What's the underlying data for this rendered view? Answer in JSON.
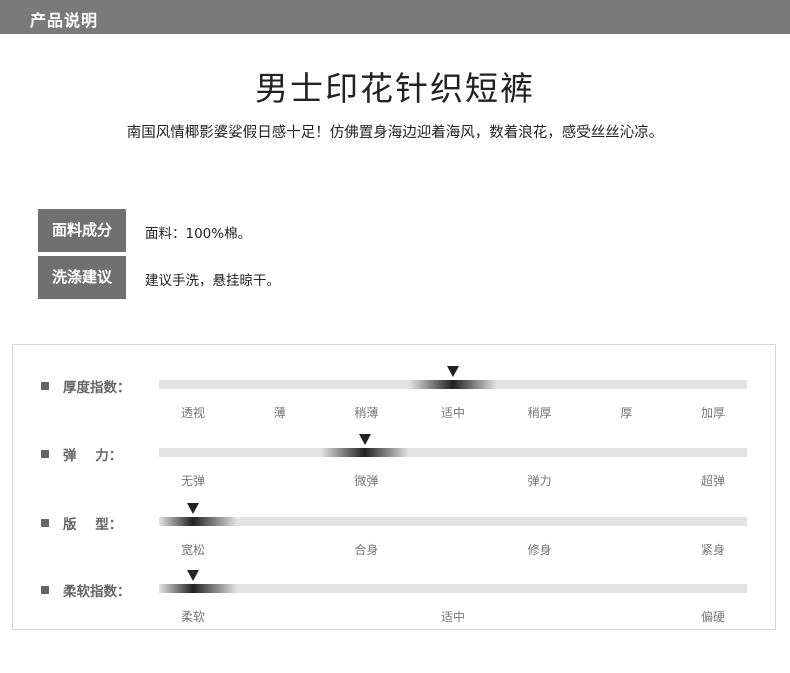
{
  "header": {
    "title": "产品说明"
  },
  "product": {
    "title": "男士印花针织短裤",
    "description": "南国风情椰影婆娑假日感十足！仿佛置身海边迎着海风，数着浪花，感受丝丝沁凉。"
  },
  "specs": [
    {
      "label": "面料成分",
      "value": "面料：100%棉。"
    },
    {
      "label": "洗涤建议",
      "value": "建议手洗，悬挂晾干。"
    }
  ],
  "indices": [
    {
      "label": "厚度指数：",
      "ticks": [
        "透视",
        "薄",
        "稍薄",
        "适中",
        "稍厚",
        "厚",
        "加厚"
      ],
      "level": 0.5
    },
    {
      "label": "弹    力：",
      "ticks": [
        "无弹",
        "微弹",
        "弹力",
        "超弹"
      ],
      "level": 0.33
    },
    {
      "label": "版    型：",
      "ticks": [
        "宽松",
        "合身",
        "修身",
        "紧身"
      ],
      "level": 0.0
    },
    {
      "label": "柔软指数：",
      "ticks": [
        "柔软",
        "适中",
        "偏硬"
      ],
      "level": 0.0
    }
  ],
  "colors": {
    "header_bg": "#7a7a7a",
    "label_bg": "#707070",
    "bar_bg": "#e3e3e3",
    "marker": "#222222"
  }
}
